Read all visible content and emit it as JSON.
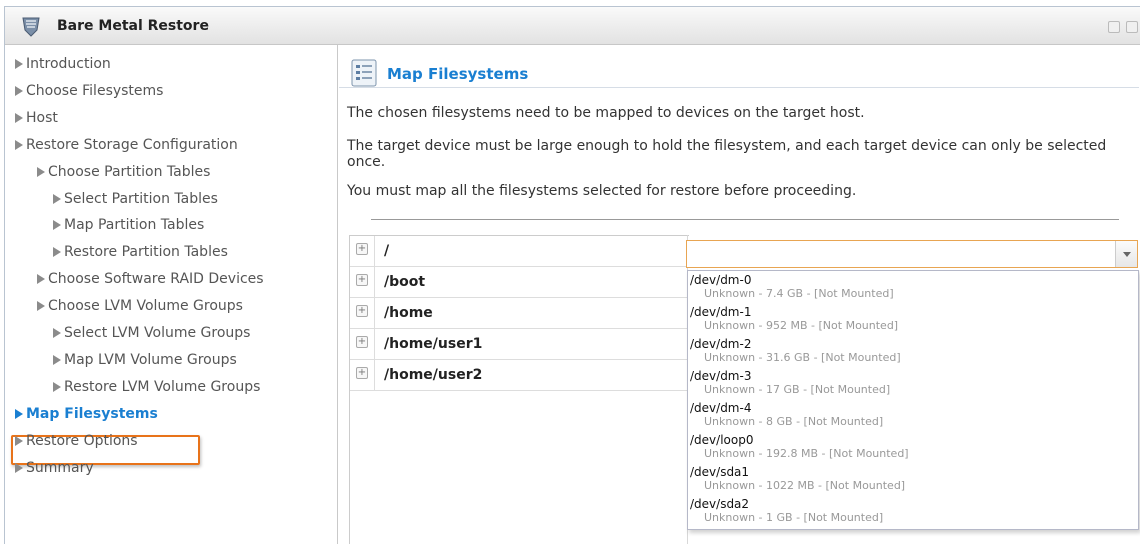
{
  "window": {
    "title": "Bare Metal Restore",
    "icon": "shield-icon"
  },
  "sidebar": {
    "items": [
      {
        "label": "Introduction",
        "level": 0,
        "active": false
      },
      {
        "label": "Choose Filesystems",
        "level": 0,
        "active": false
      },
      {
        "label": "Host",
        "level": 0,
        "active": false
      },
      {
        "label": "Restore Storage Configuration",
        "level": 0,
        "active": false
      },
      {
        "label": "Choose Partition Tables",
        "level": 1,
        "active": false
      },
      {
        "label": "Select Partition Tables",
        "level": 2,
        "active": false
      },
      {
        "label": "Map Partition Tables",
        "level": 2,
        "active": false
      },
      {
        "label": "Restore Partition Tables",
        "level": 2,
        "active": false
      },
      {
        "label": "Choose Software RAID Devices",
        "level": 1,
        "active": false
      },
      {
        "label": "Choose LVM Volume Groups",
        "level": 1,
        "active": false
      },
      {
        "label": "Select LVM Volume Groups",
        "level": 2,
        "active": false
      },
      {
        "label": "Map LVM Volume Groups",
        "level": 2,
        "active": false
      },
      {
        "label": "Restore LVM Volume Groups",
        "level": 2,
        "active": false
      },
      {
        "label": "Map Filesystems",
        "level": 0,
        "active": true
      },
      {
        "label": "Restore Options",
        "level": 0,
        "active": false
      },
      {
        "label": "Summary",
        "level": 0,
        "active": false
      }
    ],
    "active_color": "#1a7fd1",
    "highlight_color": "#e8731a"
  },
  "panel": {
    "title": "Map Filesystems",
    "paragraphs": [
      "The chosen filesystems need to be mapped to devices on the target host.",
      "The target device must be large enough to hold the filesystem, and each target device can only be selected once.",
      "You must map all the filesystems selected for restore before proceeding."
    ]
  },
  "filesystems": [
    {
      "name": "/"
    },
    {
      "name": "/boot"
    },
    {
      "name": "/home"
    },
    {
      "name": "/home/user1"
    },
    {
      "name": "/home/user2"
    }
  ],
  "combo": {
    "value": "",
    "expanded": true
  },
  "devices": [
    {
      "device": "/dev/dm-0",
      "info": "Unknown - 7.4 GB - [Not Mounted]"
    },
    {
      "device": "/dev/dm-1",
      "info": "Unknown - 952 MB - [Not Mounted]"
    },
    {
      "device": "/dev/dm-2",
      "info": "Unknown - 31.6 GB - [Not Mounted]"
    },
    {
      "device": "/dev/dm-3",
      "info": "Unknown - 17 GB - [Not Mounted]"
    },
    {
      "device": "/dev/dm-4",
      "info": "Unknown - 8 GB - [Not Mounted]"
    },
    {
      "device": "/dev/loop0",
      "info": "Unknown - 192.8 MB - [Not Mounted]"
    },
    {
      "device": "/dev/sda1",
      "info": "Unknown - 1022 MB - [Not Mounted]"
    },
    {
      "device": "/dev/sda2",
      "info": "Unknown - 1 GB - [Not Mounted]"
    }
  ]
}
